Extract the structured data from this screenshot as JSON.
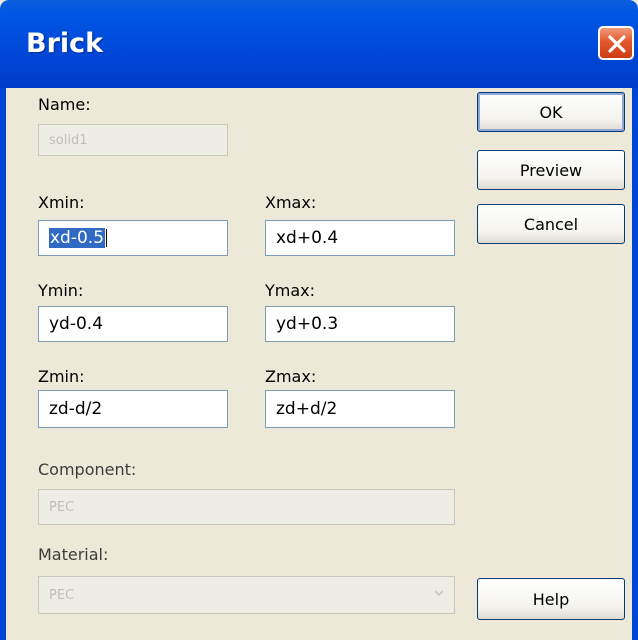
{
  "window": {
    "title": "Brick"
  },
  "form": {
    "name": {
      "label": "Name:",
      "value": "solid1"
    },
    "xmin": {
      "label": "Xmin:",
      "value": "xd-0.5"
    },
    "xmax": {
      "label": "Xmax:",
      "value": "xd+0.4"
    },
    "ymin": {
      "label": "Ymin:",
      "value": "yd-0.4"
    },
    "ymax": {
      "label": "Ymax:",
      "value": "yd+0.3"
    },
    "zmin": {
      "label": "Zmin:",
      "value": "zd-d/2"
    },
    "zmax": {
      "label": "Zmax:",
      "value": "zd+d/2"
    },
    "component": {
      "label": "Component:",
      "value": "PEC"
    },
    "material": {
      "label": "Material:",
      "value": "PEC"
    }
  },
  "buttons": {
    "ok": "OK",
    "preview": "Preview",
    "cancel": "Cancel",
    "help": "Help"
  },
  "colors": {
    "titlebar": "#0047d8",
    "dialog_bg": "#ece9d8",
    "selection": "#316ac5",
    "close": "#e2582f"
  },
  "icons": {
    "close": "close-x-icon",
    "dropdown": "chevron-down-icon"
  }
}
